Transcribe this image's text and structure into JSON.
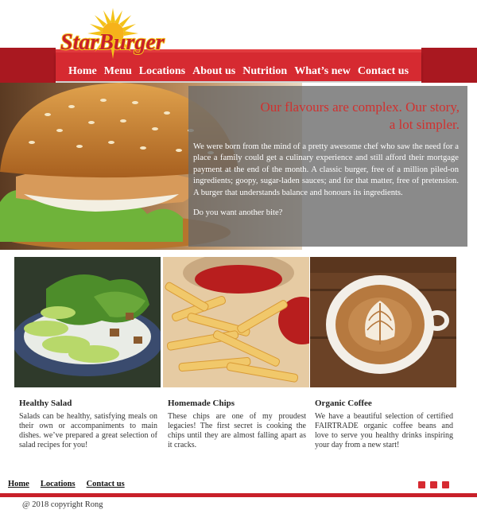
{
  "brand": {
    "logo_text": "StarBurger",
    "colors": {
      "primary_red": "#c8202a",
      "logo_yellow": "#f3c21a",
      "panel_gray": "#6b6b6b"
    }
  },
  "nav": {
    "items": [
      "Home",
      "Menu",
      "Locations",
      "About us",
      "Nutrition",
      "What’s new",
      "Contact us"
    ]
  },
  "hero": {
    "title_line1": "Our flavours are complex. Our story,",
    "title_line2": "a lot simpler.",
    "text": "We were born from the mind of a pretty awesome chef who saw the need for a place a family could get a culinary experience and still afford their mortgage payment at the end of the month. A classic burger, free of a million piled-on ingredients; goopy, sugar-laden sauces; and for that matter, free of pretension. A burger that understands balance and honours its ingredients.",
    "question": "Do you want another bite?"
  },
  "cards": [
    {
      "title": "Healthy Salad",
      "text": "Salads can be healthy, satisfying meals on their own or accompaniments to main dishes.  we’ve prepared a great selection of salad recipes for you!"
    },
    {
      "title": "Homemade Chips",
      "text": "These chips are one of my proudest legacies! The first secret is cooking the chips until they are almost falling apart as it cracks."
    },
    {
      "title": "Organic Coffee",
      "text": "We have a beautiful selection of certified FAIRTRADE organic coffee beans and love to serve you healthy drinks inspiring your day from a new start!"
    }
  ],
  "footer": {
    "links": [
      "Home",
      "Locations",
      "Contact us"
    ],
    "social_icons": [
      "instagram-icon",
      "twitter-icon",
      "facebook-icon"
    ],
    "copyright": "@  2018 copyright  Rong"
  }
}
